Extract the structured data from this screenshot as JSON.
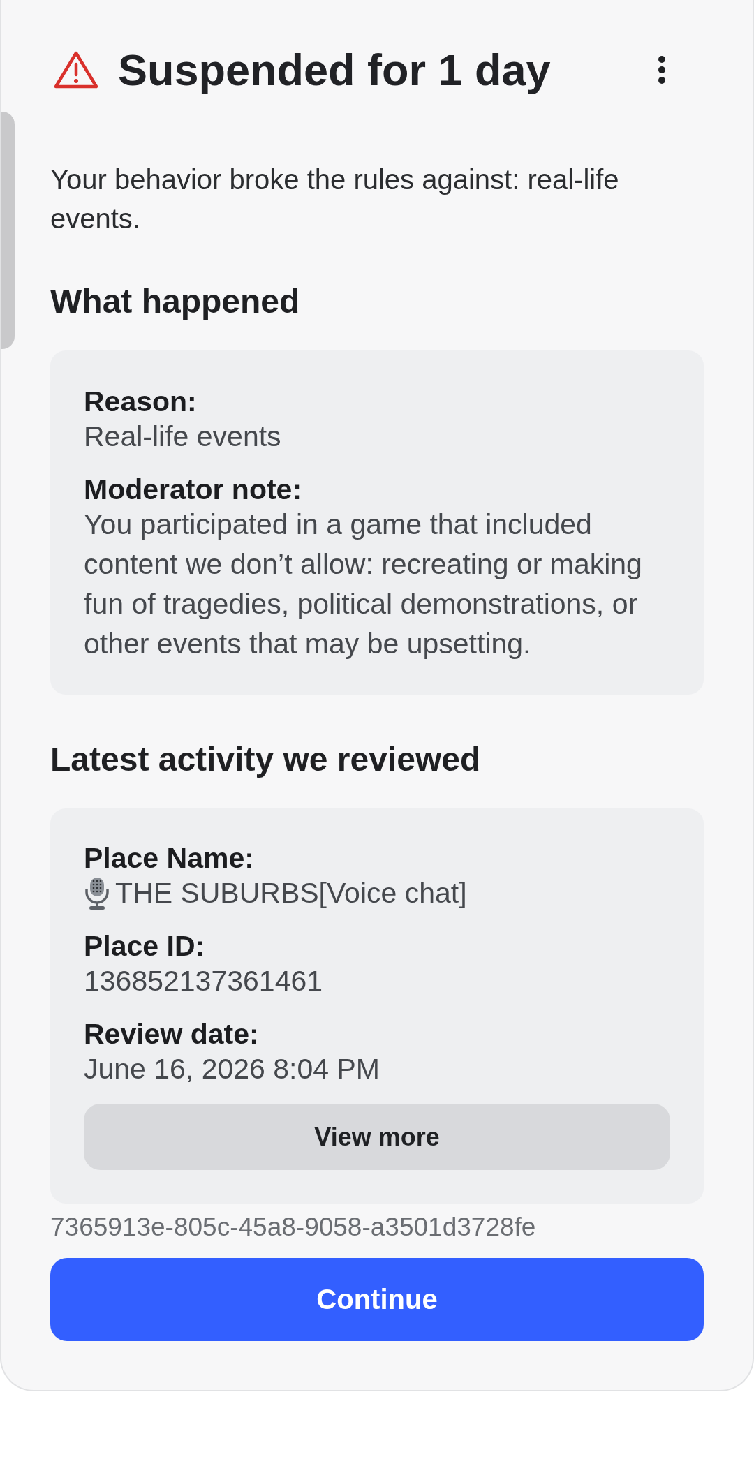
{
  "dialog": {
    "title": "Suspended for 1 day",
    "message": "Your behavior broke the rules against: real-life events."
  },
  "sections": [
    {
      "heading": "What happened",
      "fields": [
        {
          "label": "Reason:",
          "value": "Real-life events",
          "kind": "plain"
        },
        {
          "label": "Moderator note:",
          "value": "You participated in a game that included content we don’t allow: recreating or making fun of tragedies, political demonstrations, or other events that may be upsetting.",
          "kind": "plain"
        }
      ]
    },
    {
      "heading": "Latest activity we reviewed",
      "fields": [
        {
          "label": "Place Name:",
          "value": "THE SUBURBS[Voice chat]",
          "kind": "with_icon"
        },
        {
          "label": "Place ID:",
          "value": "136852137361461",
          "kind": "plain"
        },
        {
          "label": "Review date:",
          "value": "June 16, 2026 8:04 PM",
          "kind": "plain"
        }
      ],
      "button": "View more"
    }
  ],
  "reference_id": "7365913e-805c-45a8-9058-a3501d3728fe",
  "primary_button": "Continue"
}
